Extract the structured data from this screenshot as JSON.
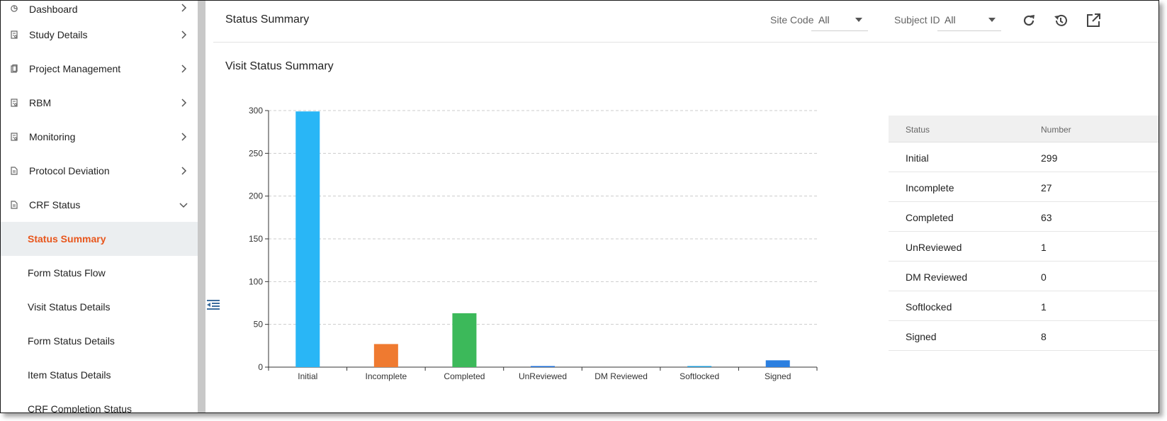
{
  "sidebar": {
    "nav": [
      {
        "label": "Dashboard",
        "icon": "pie-chart-icon",
        "expanded": false
      },
      {
        "label": "Study Details",
        "icon": "document-icon",
        "expanded": false
      },
      {
        "label": "Project Management",
        "icon": "clipboard-icon",
        "expanded": false
      },
      {
        "label": "RBM",
        "icon": "document-icon",
        "expanded": false
      },
      {
        "label": "Monitoring",
        "icon": "document-icon",
        "expanded": false
      },
      {
        "label": "Protocol Deviation",
        "icon": "file-icon",
        "expanded": false
      },
      {
        "label": "CRF Status",
        "icon": "file-icon",
        "expanded": true
      }
    ],
    "sub_items": [
      {
        "label": "Status Summary",
        "active": true
      },
      {
        "label": "Form Status Flow",
        "active": false
      },
      {
        "label": "Visit Status Details",
        "active": false
      },
      {
        "label": "Form Status Details",
        "active": false
      },
      {
        "label": "Item Status Details",
        "active": false
      },
      {
        "label": "CRF Completion Status",
        "active": false
      }
    ]
  },
  "header": {
    "title": "Status Summary",
    "site_code": {
      "label": "Site Code",
      "value": "All"
    },
    "subject_id": {
      "label": "Subject ID",
      "value": "All"
    },
    "icons": [
      "refresh-icon",
      "history-icon",
      "open-external-icon"
    ]
  },
  "section": {
    "title": "Visit Status Summary"
  },
  "chart_data": {
    "type": "bar",
    "categories": [
      "Initial",
      "Incomplete",
      "Completed",
      "UnReviewed",
      "DM Reviewed",
      "Softlocked",
      "Signed"
    ],
    "values": [
      299,
      27,
      63,
      1,
      0,
      1,
      8
    ],
    "colors": [
      "#29b6f6",
      "#ef7a30",
      "#3cb95a",
      "#1e6fd9",
      "#1e6fd9",
      "#1e9bd9",
      "#2b7fe0"
    ],
    "ylim": [
      0,
      300
    ],
    "yticks": [
      0,
      50,
      100,
      150,
      200,
      250,
      300
    ],
    "grid": true,
    "title": "",
    "xlabel": "",
    "ylabel": ""
  },
  "table": {
    "headers": [
      "Status",
      "Number"
    ],
    "rows": [
      [
        "Initial",
        "299"
      ],
      [
        "Incomplete",
        "27"
      ],
      [
        "Completed",
        "63"
      ],
      [
        "UnReviewed",
        "1"
      ],
      [
        "DM Reviewed",
        "0"
      ],
      [
        "Softlocked",
        "1"
      ],
      [
        "Signed",
        "8"
      ]
    ]
  },
  "colors": {
    "accent": "#e8561c",
    "active_bg": "#ebeef0"
  }
}
